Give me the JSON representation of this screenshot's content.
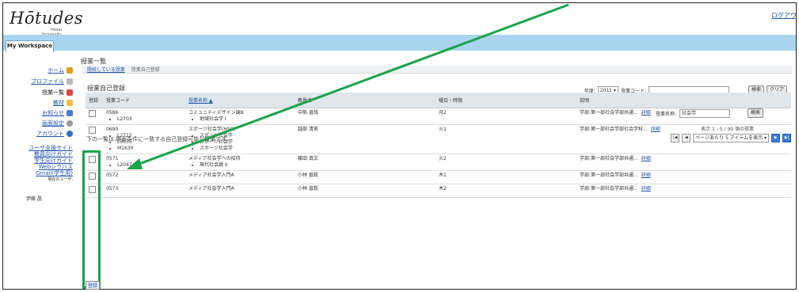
{
  "header": {
    "logo_text": "Hōtudes",
    "logo_sub_1": "Hosei",
    "logo_sub_2": "University",
    "logout_label": "ログアウ",
    "workspace_tab": "My Workspace"
  },
  "sidebar": {
    "items": [
      {
        "label": "ホーム"
      },
      {
        "label": "プロファイル"
      },
      {
        "label": "授業一覧"
      },
      {
        "label": "教材"
      },
      {
        "label": "お知らせ"
      },
      {
        "label": "画面設定"
      },
      {
        "label": "アカウント"
      }
    ],
    "links": [
      "ユーザ支援サイト",
      "教員向けガイド",
      "学生向けガイド",
      "Webシラバス",
      "Gmail(学生用)"
    ],
    "user_label": "現在のユーザ:",
    "user_name": "伊藤 晶"
  },
  "main": {
    "tool_title": "授業一覧",
    "breadcrumb_link": "開校している授業",
    "breadcrumb_current": "授業自己登録",
    "page_subtitle": "授業自己登録",
    "year_label": "年度:",
    "year_value": "2011",
    "code_label": "授業コード:",
    "search_button": "検索",
    "clear_button": "クリア",
    "name_label": "授業名称:",
    "name_value": "社会学",
    "search_button_2": "検索",
    "count_text": "表示 1 - 5 / 99 個の授業",
    "page_size_text": "ページあたり 5 アイテムを表示",
    "instruction": "下の一覧は,検索条件に一致する自己登録可能な授業です。",
    "submit_label": "登録"
  },
  "table": {
    "headers": [
      "登録",
      "授業コード",
      "授業名称 ▲",
      "教員名",
      "曜日・時限",
      "説明"
    ],
    "rows": [
      {
        "code": "0586",
        "subcodes": [
          "L2703"
        ],
        "name": "コミュニティデザイン論B",
        "subnames": [
          "地域社会学 I"
        ],
        "teacher": "中筋 直哉",
        "time": "月2",
        "desc": "学部:第一部社会学部共通..."
      },
      {
        "code": "0690",
        "subcodes": [
          "L2712",
          "L3035",
          "M1630"
        ],
        "name": "スポーツ社会学(HSC)",
        "subnames": [
          "スポーツ社会学",
          "スポーツ社会学",
          "スポーツ社会学"
        ],
        "teacher": "越部 清美",
        "time": "火1",
        "desc": "学部:第一部社会学部社会学科..."
      },
      {
        "code": "0571",
        "subcodes": [
          "L2047"
        ],
        "name": "メディア社会学への招待",
        "subnames": [
          "現代社会論 II"
        ],
        "teacher": "藤田 真文",
        "time": "火2",
        "desc": "学部:第一部社会学部共通..."
      },
      {
        "code": "0572",
        "subcodes": [],
        "name": "メディア社会学入門A",
        "subnames": [],
        "teacher": "小林 直毅",
        "time": "木1",
        "desc": "学部:第一部社会学部共通..."
      },
      {
        "code": "0573",
        "subcodes": [],
        "name": "メディア社会学入門A",
        "subnames": [],
        "teacher": "小林 直毅",
        "time": "木2",
        "desc": "学部:第一部社会学部共通..."
      }
    ],
    "detail_label": "詳細"
  },
  "colors": {
    "accent_bar": "#a9d6ee",
    "highlight": "#1aa34a",
    "link": "#2255aa"
  }
}
